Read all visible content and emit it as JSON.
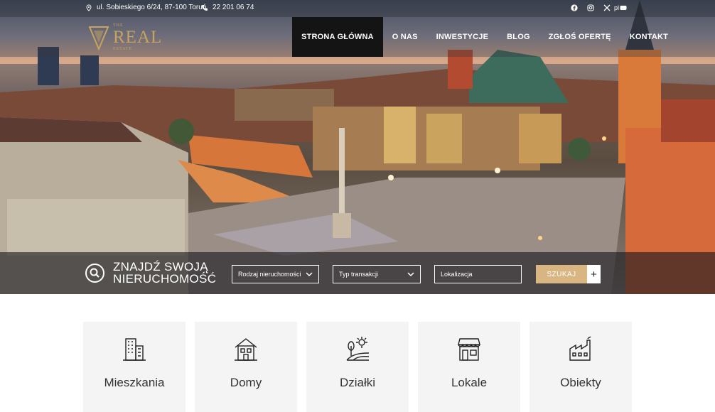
{
  "topbar": {
    "address": "ul. Sobieskiego 6/24, 87-100 Toruń",
    "phone": "22 201 06 74",
    "social_icons": [
      "facebook-icon",
      "instagram-icon",
      "x-icon",
      "youtube-icon"
    ],
    "language": "pl"
  },
  "logo": {
    "top_text": "THE",
    "word": "REAL",
    "bottom_text": "ESTATE"
  },
  "nav": {
    "items": [
      {
        "label": "STRONA GŁÓWNA",
        "active": true
      },
      {
        "label": "O NAS",
        "active": false
      },
      {
        "label": "INWESTYCJE",
        "active": false
      },
      {
        "label": "BLOG",
        "active": false
      },
      {
        "label": "ZGŁOŚ OFERTĘ",
        "active": false
      },
      {
        "label": "KONTAKT",
        "active": false
      }
    ]
  },
  "search": {
    "heading_line1": "ZNAJDŹ SWOJĄ",
    "heading_line2": "NIERUCHOMOŚĆ",
    "property_type": "Rodzaj nieruchomości",
    "transaction_type": "Typ transakcji",
    "location_placeholder": "Lokalizacja",
    "search_label": "SZUKAJ",
    "more_label": "+"
  },
  "categories": [
    {
      "label": "Mieszkania",
      "icon": "apartment-building-icon"
    },
    {
      "label": "Domy",
      "icon": "house-icon"
    },
    {
      "label": "Działki",
      "icon": "land-plot-icon"
    },
    {
      "label": "Lokale",
      "icon": "shop-storefront-icon"
    },
    {
      "label": "Obiekty",
      "icon": "factory-icon"
    }
  ],
  "colors": {
    "accent_gold": "#c9a25e",
    "search_button": "#d9b582",
    "active_nav": "#141414"
  }
}
